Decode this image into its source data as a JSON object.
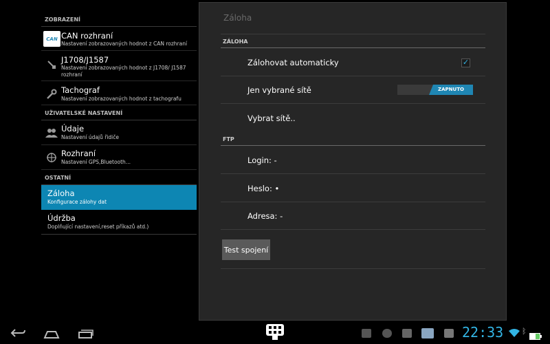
{
  "left": {
    "sections": [
      {
        "label": "ZOBRAZENÍ"
      },
      {
        "label": "UŽIVATELSKÉ NASTAVENÍ"
      },
      {
        "label": "OSTATNÍ"
      }
    ],
    "items": [
      {
        "title": "CAN rozhraní",
        "subtitle": "Nastavení zobrazovaných hodnot z CAN rozhraní",
        "icon": "can-logo-icon",
        "logo_text": "CAN"
      },
      {
        "title": "J1708/J1587",
        "subtitle": "Nastavení zobrazovaných hodnot z J1708/ J1587 rozhraní",
        "icon": "plug-icon"
      },
      {
        "title": "Tachograf",
        "subtitle": "Nastavení zobrazovaných hodnot z tachografu",
        "icon": "wrench-icon"
      },
      {
        "title": "Údaje",
        "subtitle": "Nastavení údajů řidiče",
        "icon": "users-icon"
      },
      {
        "title": "Rozhraní",
        "subtitle": "Nastavení GPS,Bluetooth...",
        "icon": "compass-icon"
      },
      {
        "title": "Záloha",
        "subtitle": "Konfigurace zálohy dat",
        "selected": true
      },
      {
        "title": "Údržba",
        "subtitle": "Doplňující nastavení,reset příkazů atd.)"
      }
    ]
  },
  "right": {
    "title": "Záloha",
    "sections": [
      {
        "label": "ZÁLOHA"
      },
      {
        "label": "FTP"
      }
    ],
    "rows": [
      {
        "label": "Zálohovat automaticky",
        "checked": true
      },
      {
        "label": "Jen vybrané sítě",
        "toggle": "ZAPNUTO"
      },
      {
        "label": "Vybrat sítě.."
      },
      {
        "label": "Login: -"
      },
      {
        "label": "Heslo: •"
      },
      {
        "label": "Adresa: -"
      }
    ],
    "test_button": "Test spojení"
  },
  "nav": {
    "clock": "22:33",
    "accent": "#33b5e5",
    "selection_color": "#0d86b3"
  }
}
